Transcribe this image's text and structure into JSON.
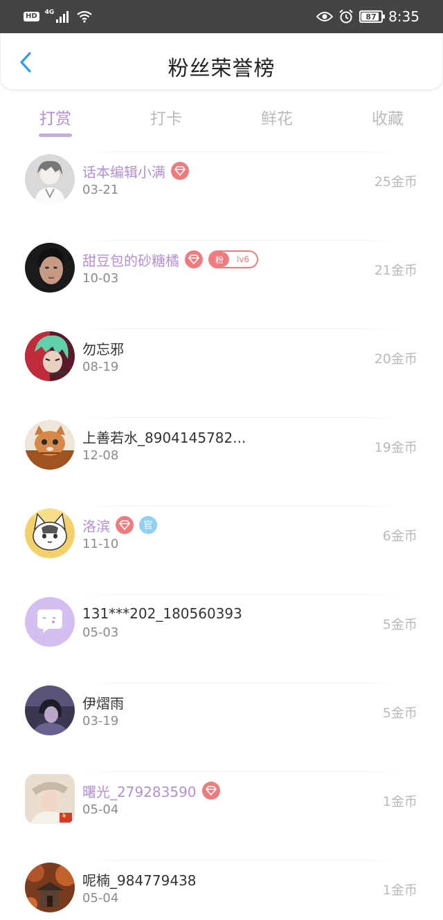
{
  "status_bar": {
    "hd": "HD",
    "network": "4G",
    "battery": "87",
    "time": "8:35"
  },
  "header": {
    "title": "粉丝荣誉榜"
  },
  "tabs": [
    {
      "label": "打赏",
      "active": true
    },
    {
      "label": "打卡",
      "active": false
    },
    {
      "label": "鲜花",
      "active": false
    },
    {
      "label": "收藏",
      "active": false
    }
  ],
  "colors": {
    "accent": "#b48ed8",
    "gem": "#f07b7f",
    "official": "#8fd0f5"
  },
  "list": [
    {
      "name": "话本编辑小满",
      "date": "03-21",
      "coins": "25金币",
      "vip": true,
      "badges": [
        "diamond-icon"
      ]
    },
    {
      "name": "甜豆包的砂糖橘",
      "date": "10-03",
      "coins": "21金币",
      "vip": true,
      "badges": [
        "diamond-icon",
        "fan-badge"
      ],
      "fan_label": "粉",
      "fan_level": "lv6"
    },
    {
      "name": "勿忘邪",
      "date": "08-19",
      "coins": "20金币",
      "vip": false,
      "badges": []
    },
    {
      "name": "上善若水_8904145782...",
      "date": "12-08",
      "coins": "19金币",
      "vip": false,
      "badges": []
    },
    {
      "name": "洛滨",
      "date": "11-10",
      "coins": "6金币",
      "vip": true,
      "badges": [
        "diamond-icon",
        "official-badge"
      ],
      "official_label": "官"
    },
    {
      "name": "131***202_180560393",
      "date": "05-03",
      "coins": "5金币",
      "vip": false,
      "badges": []
    },
    {
      "name": "伊熠雨",
      "date": "03-19",
      "coins": "5金币",
      "vip": false,
      "badges": []
    },
    {
      "name": "曙光_279283590",
      "date": "05-04",
      "coins": "1金币",
      "vip": true,
      "badges": [
        "diamond-icon"
      ]
    },
    {
      "name": "呢楠_984779438",
      "date": "05-04",
      "coins": "1金币",
      "vip": false,
      "badges": []
    }
  ]
}
